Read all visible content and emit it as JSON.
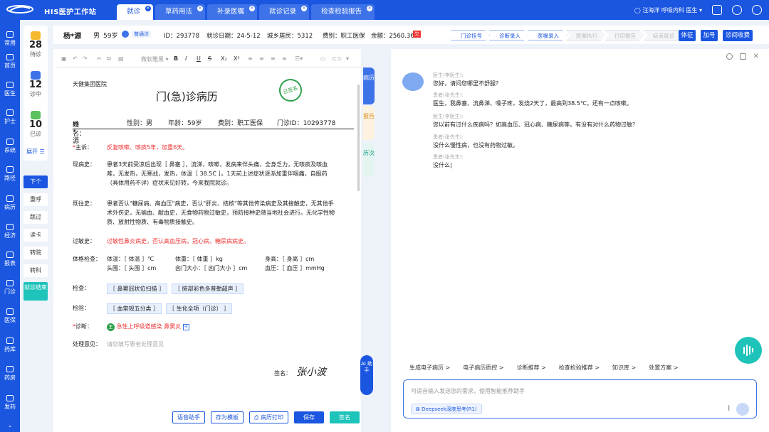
{
  "app": {
    "title": "HIS医护工作站"
  },
  "tabs": [
    {
      "label": "就诊"
    },
    {
      "label": "草药用法"
    },
    {
      "label": "补录医嘱"
    },
    {
      "label": "就诊记录"
    },
    {
      "label": "检查检验报告"
    }
  ],
  "user": {
    "name": "汪海洋",
    "dept": "呼吸内科",
    "role": "医生"
  },
  "sidebar": {
    "items": [
      {
        "label": "常用",
        "icon": "star-icon"
      },
      {
        "label": "首页",
        "icon": "home-icon"
      },
      {
        "label": "医生",
        "icon": "doctor-icon"
      },
      {
        "label": "护士",
        "icon": "nurse-icon"
      },
      {
        "label": "系统",
        "icon": "gear-icon"
      },
      {
        "label": "路径",
        "icon": "path-icon"
      },
      {
        "label": "病历",
        "icon": "record-icon"
      },
      {
        "label": "经济",
        "icon": "money-icon"
      },
      {
        "label": "报表",
        "icon": "chart-icon"
      },
      {
        "label": "门诊",
        "icon": "stethoscope-icon"
      },
      {
        "label": "医保",
        "icon": "insurance-icon"
      },
      {
        "label": "药库",
        "icon": "warehouse-icon"
      },
      {
        "label": "药房",
        "icon": "pharmacy-icon"
      },
      {
        "label": "发药",
        "icon": "dispense-icon"
      }
    ]
  },
  "queue": {
    "waiting": {
      "count": "28",
      "label": "待诊"
    },
    "in_progress": {
      "count": "12",
      "label": "诊中"
    },
    "done": {
      "count": "10",
      "label": "已诊"
    },
    "expand": "展开 ☰"
  },
  "actions": [
    "下个",
    "重呼",
    "跳过",
    "读卡",
    "转院",
    "转科",
    "就诊结束"
  ],
  "patient": {
    "name": "杨*源",
    "sex": "男",
    "age": "59岁",
    "type": "普通诊",
    "id": "ID：293778",
    "visit_date": "就诊日期：24-5-12",
    "insurance": "城乡居民：5312",
    "fee": "费别：职工医保",
    "balance": "余额：2560.36"
  },
  "steps": [
    "门诊挂号",
    "诊断录入",
    "医嘱录入",
    "医嘱执行",
    "打印报告",
    "结束就诊"
  ],
  "patient_buttons": {
    "cert": "体征",
    "add": "加号",
    "fee": "诊间收费"
  },
  "toolbar": {
    "font": "微软雅黑"
  },
  "record": {
    "hospital": "天健集团医院",
    "title": "门(急)诊病历",
    "stamp": "已签名",
    "name_label": "姓名：",
    "name": "杨*源",
    "sex": "性别：男",
    "age": "年龄：59岁",
    "fee": "费别：职工医保",
    "clinic_id": "门诊ID：10293778",
    "complaint_label": "主诉：",
    "complaint": "反复咳嗽、咳痰5年，加重6天。",
    "history_label": "现病史：",
    "history": "患者3天前受凉后出现［ 鼻塞 ］，流涕，咳嗽，发病来伴头痛，全身乏力，无咳痰及咳血难，无发热，无寒战，发热，体温［ 38.5C ］。1天前上述症状逐渐加重伴咽痛，自服药（具体用药不详）症状未见好转，今来我院就诊。",
    "past_label": "既往史：",
    "past": "患者否认\"糖尿病、高血压\"病史，否认\"肝炎、结核\"等其他传染病史及其接触史，无其他手术外伤史，无输血、献血史，无食物药物过敏史，预防接种史随当地社会进行。无化学性物质、放射性物质、有毒物质接触史。",
    "allergy_label": "过敏史：",
    "allergy": "过敏性鼻炎病史，否认高血压病，冠心病，糖尿病病史。",
    "exam_label": "体格检查：",
    "exam_row1": [
      "体温：［ 体温 ］℃",
      "体重：［ 体重 ］kg",
      "身高：［ 身高 ］cm"
    ],
    "exam_row2": [
      "头围：［ 头围 ］cm",
      "囟门大小：［ 囟门大小 ］cm",
      "血压：［ 血压 ］mmHg"
    ],
    "check_label": "检查：",
    "checks": [
      "［ 鼻窦冠状位扫描 ］",
      "［ 肺部彩色多普勒超声 ］"
    ],
    "test_label": "检验：",
    "tests": [
      "［ 血常规五分类 ］",
      "［ 生化全项（门诊） ］"
    ],
    "diag_label": "诊断：",
    "diag_badge": "主",
    "diagnosis": "急性上呼吸道感染  鼻窦炎",
    "plan_label": "处理意见：",
    "plan_placeholder": "请您填写患者处理意见",
    "sign_label": "签名：",
    "signature": "张小波"
  },
  "vertical_tabs": [
    "病历",
    "报告",
    "历次"
  ],
  "ai_button": "AI 助手",
  "bottom_buttons": [
    "语音助手",
    "存为模板",
    "病历打印",
    "保存",
    "签名"
  ],
  "chat": {
    "messages": [
      {
        "who": "医生(李医生):",
        "text": "您好，请问您哪里不舒服？"
      },
      {
        "who": "患者(张先生):",
        "text": "医生，我鼻塞、流鼻涕、嗓子疼，发烧2天了，最高到38.5℃，还有一点咳嗽。"
      },
      {
        "who": "医生(李医生):",
        "text": "您以前有过什么疾病吗？如高血压、冠心病、糖尿病等。有没有对什么药物过敏？"
      },
      {
        "who": "患者(张先生):",
        "text": "没什么慢性病，也没有药物过敏。"
      },
      {
        "who": "患者(张先生):",
        "text": "没什么|"
      }
    ],
    "quick": [
      "生成电子病历 >",
      "电子病历质控 >",
      "诊断推荐 >",
      "检查检验推荐 >",
      "知识库 >",
      "处置方案 >"
    ],
    "input_placeholder": "可语音输入发送您的需求，使用智能推荐助手",
    "deepseek": "Deepseek深度思考(R1)"
  },
  "colors": {
    "brand": "#1a56e0",
    "teal": "#1ec3b9",
    "red": "#e33333"
  }
}
